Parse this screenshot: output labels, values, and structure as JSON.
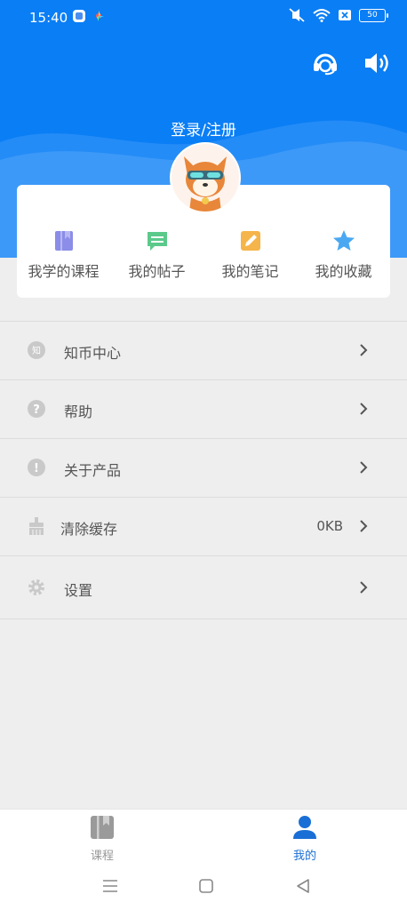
{
  "status_bar": {
    "time": "15:40",
    "battery": "50"
  },
  "header": {
    "login_label": "登录/注册",
    "accent_color": "#0a7ef5",
    "actions": [
      {
        "icon": "headset-icon"
      },
      {
        "icon": "speaker-icon"
      }
    ]
  },
  "shortcuts": [
    {
      "label": "我学的课程",
      "icon": "course-book-icon",
      "color": "#8b8de8"
    },
    {
      "label": "我的帖子",
      "icon": "chat-bubble-icon",
      "color": "#5bc98a"
    },
    {
      "label": "我的笔记",
      "icon": "note-pencil-icon",
      "color": "#f5b54a"
    },
    {
      "label": "我的收藏",
      "icon": "star-icon",
      "color": "#4aa8f2"
    }
  ],
  "menu": [
    {
      "label": "知币中心",
      "icon": "coin-icon",
      "icon_text": "知",
      "value": ""
    },
    {
      "label": "帮助",
      "icon": "help-icon",
      "icon_text": "?",
      "value": ""
    },
    {
      "label": "关于产品",
      "icon": "info-icon",
      "icon_text": "!",
      "value": ""
    },
    {
      "label": "清除缓存",
      "icon": "broom-icon",
      "icon_text": "",
      "value": "0KB"
    },
    {
      "label": "设置",
      "icon": "gear-icon",
      "icon_text": "",
      "value": ""
    }
  ],
  "bottom_nav": [
    {
      "label": "课程",
      "icon": "course-tab-icon",
      "active": false
    },
    {
      "label": "我的",
      "icon": "profile-tab-icon",
      "active": true
    }
  ],
  "system_nav": [
    "menu-icon",
    "home-icon",
    "back-icon"
  ]
}
